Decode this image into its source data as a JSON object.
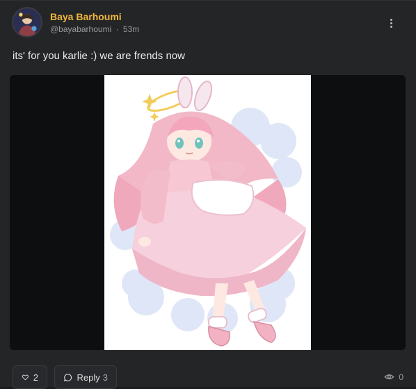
{
  "post": {
    "author_name": "Baya Barhoumi",
    "handle": "@bayabarhoumi",
    "separator": "·",
    "time_ago": "53m",
    "text": "its' for you karlie :) we are frends now"
  },
  "media": {
    "alt": "Illustration of a pink-haired girl with bunny ears and a halo in a pink frilly dress on clouds"
  },
  "actions": {
    "like_count": "2",
    "reply_label": "Reply",
    "reply_count": "3",
    "view_count": "0"
  },
  "icons": {
    "menu": "more-vertical-icon",
    "like": "heart-icon",
    "reply": "speech-bubble-icon",
    "views": "eye-icon"
  },
  "colors": {
    "author_name": "#f0b63a",
    "card_bg": "#242527",
    "media_bg": "#0d0e0f"
  }
}
